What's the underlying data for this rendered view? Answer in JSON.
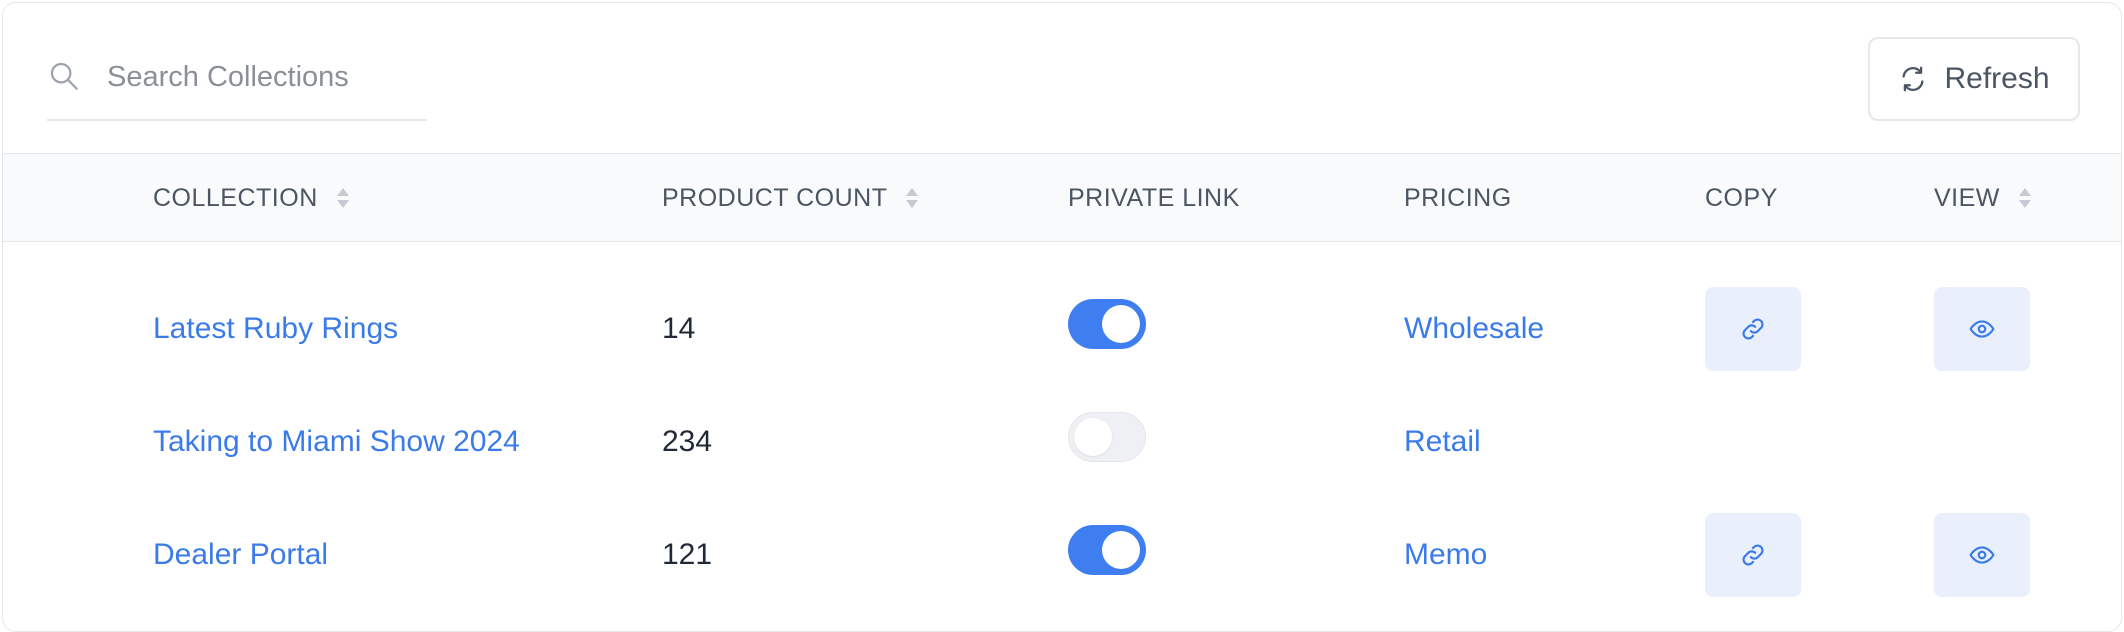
{
  "search": {
    "placeholder": "Search Collections",
    "value": ""
  },
  "toolbar": {
    "refresh_label": "Refresh"
  },
  "table": {
    "columns": {
      "collection": "COLLECTION",
      "product_count": "PRODUCT COUNT",
      "private_link": "PRIVATE LINK",
      "pricing": "PRICING",
      "copy": "COPY",
      "view": "VIEW"
    },
    "rows": [
      {
        "collection": "Latest Ruby Rings",
        "product_count": "14",
        "private_link": true,
        "pricing": "Wholesale"
      },
      {
        "collection": "Taking to Miami Show 2024",
        "product_count": "234",
        "private_link": false,
        "pricing": "Retail"
      },
      {
        "collection": "Dealer Portal",
        "product_count": "121",
        "private_link": true,
        "pricing": "Memo"
      }
    ]
  },
  "colors": {
    "accent": "#3f7ef0",
    "link": "#3b7be9",
    "action_button_bg": "#e9f0fc",
    "header_bg": "#f8fafc"
  },
  "icons": {
    "search": "search-icon",
    "refresh": "refresh-icon",
    "sort": "sort-icon",
    "copy": "link-icon",
    "view": "eye-icon"
  }
}
